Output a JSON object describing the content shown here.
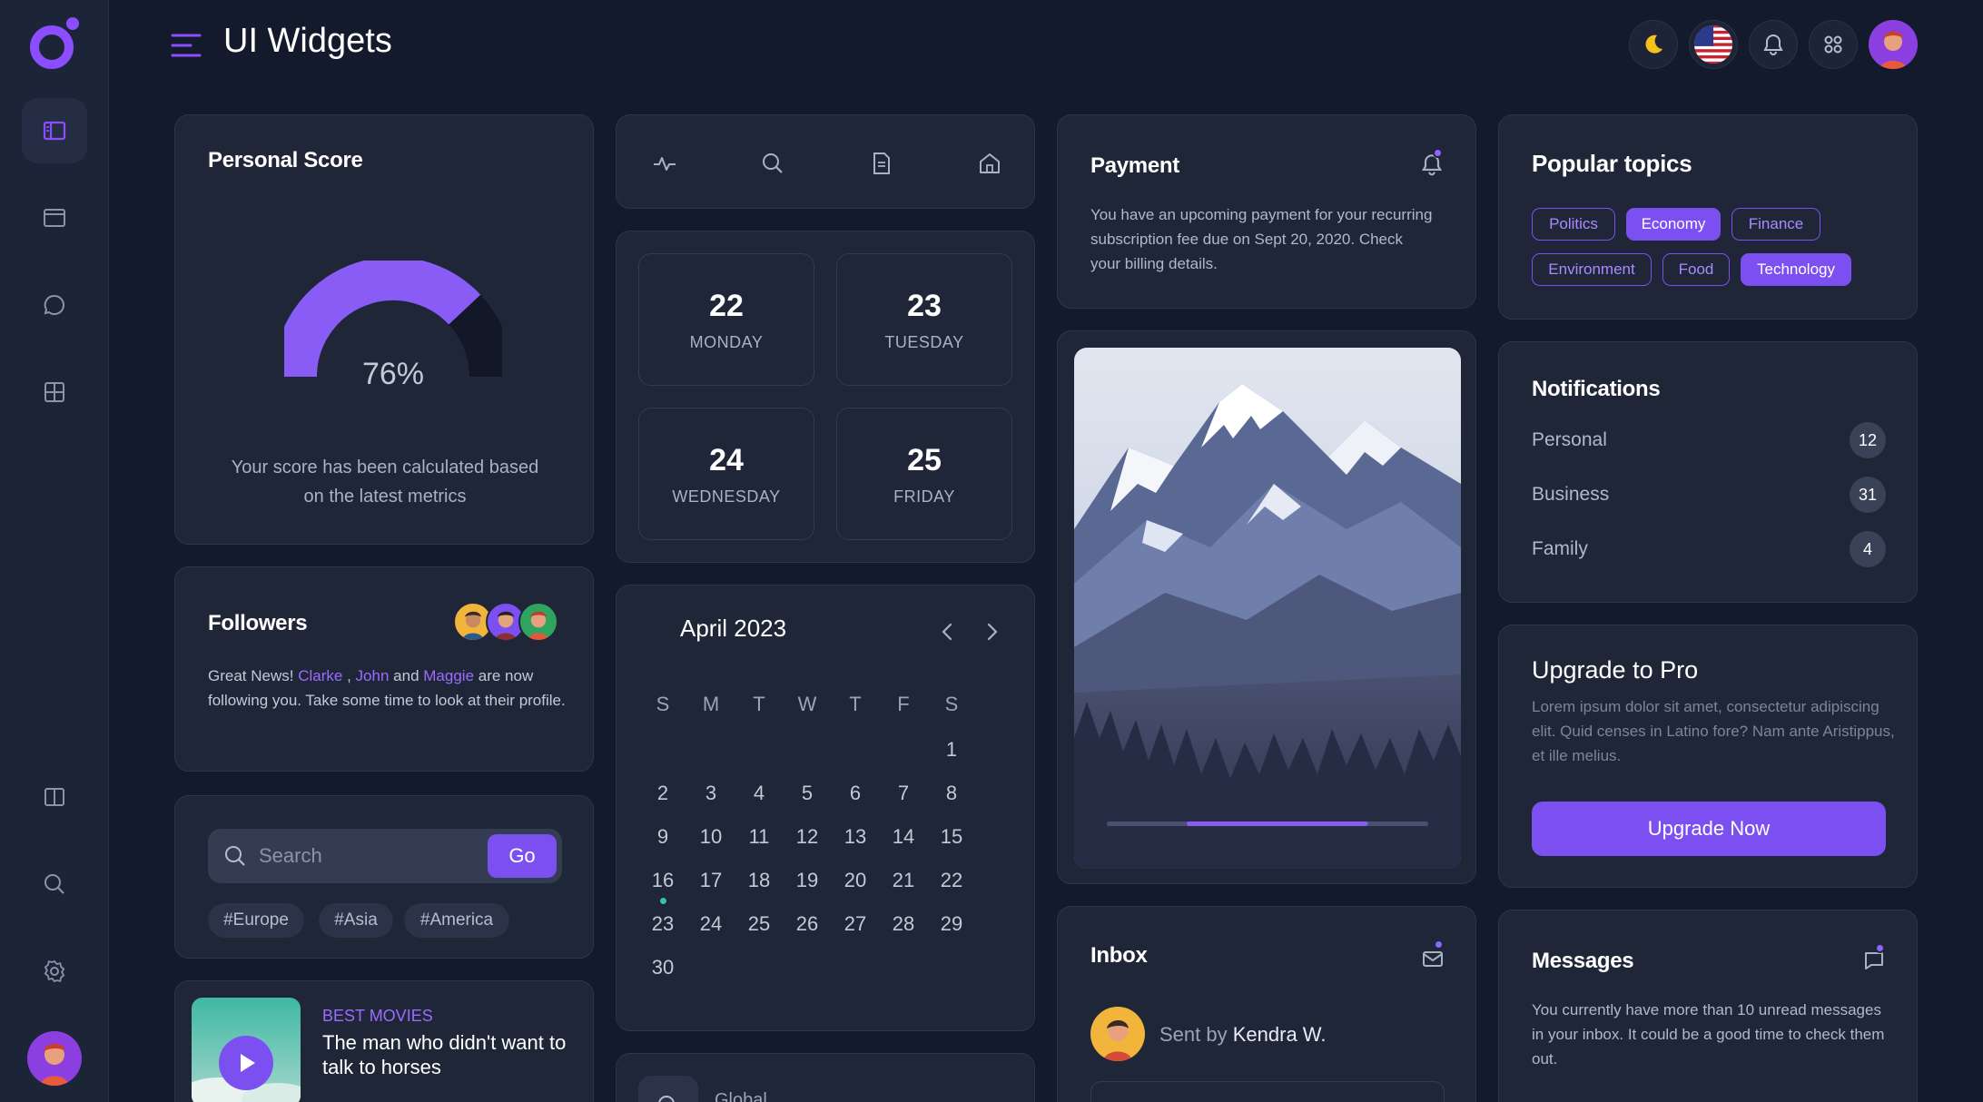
{
  "header": {
    "title": "UI Widgets"
  },
  "personal_score": {
    "title": "Personal Score",
    "value": 76,
    "value_label": "76%",
    "description_line1": "Your score has been calculated based",
    "description_line2": "on the latest metrics"
  },
  "followers": {
    "title": "Followers",
    "text_prefix": "Great News!",
    "name1": "Clarke",
    "sep1": ",",
    "name2": "John",
    "and": "and",
    "name3": "Maggie",
    "text_suffix": "are now following you. Take some time to look at their profile."
  },
  "search": {
    "placeholder": "Search",
    "go_label": "Go",
    "tags": [
      "#Europe",
      "#Asia",
      "#America"
    ]
  },
  "movie": {
    "category": "BEST MOVIES",
    "title": "The man who didn't want to talk to horses"
  },
  "dates": [
    {
      "day": "22",
      "weekday": "MONDAY"
    },
    {
      "day": "23",
      "weekday": "TUESDAY"
    },
    {
      "day": "24",
      "weekday": "WEDNESDAY"
    },
    {
      "day": "25",
      "weekday": "FRIDAY"
    }
  ],
  "calendar": {
    "title": "April 2023",
    "weekday_headers": [
      "S",
      "M",
      "T",
      "W",
      "T",
      "F",
      "S"
    ],
    "rows": [
      [
        "",
        "",
        "",
        "",
        "",
        "",
        "1"
      ],
      [
        "2",
        "3",
        "4",
        "5",
        "6",
        "7",
        "8"
      ],
      [
        "9",
        "10",
        "11",
        "12",
        "13",
        "14",
        "15"
      ],
      [
        "16",
        "17",
        "18",
        "19",
        "20",
        "21",
        "22"
      ],
      [
        "23",
        "24",
        "25",
        "26",
        "27",
        "28",
        "29"
      ],
      [
        "30",
        "",
        "",
        "",
        "",
        "",
        ""
      ]
    ],
    "today": "16"
  },
  "global_card": {
    "label": "Global"
  },
  "payment": {
    "title": "Payment",
    "text": "You have an upcoming payment for your recurring subscription fee due on Sept 20, 2020. Check your billing details."
  },
  "image_card": {
    "progress": 0.75
  },
  "inbox": {
    "title": "Inbox",
    "sent_by_label": "Sent by",
    "sender": "Kendra W."
  },
  "topics": {
    "title": "Popular topics",
    "items": [
      {
        "label": "Politics",
        "selected": false
      },
      {
        "label": "Economy",
        "selected": true
      },
      {
        "label": "Finance",
        "selected": false
      },
      {
        "label": "Environment",
        "selected": false
      },
      {
        "label": "Food",
        "selected": false
      },
      {
        "label": "Technology",
        "selected": true
      }
    ]
  },
  "notifications": {
    "title": "Notifications",
    "items": [
      {
        "label": "Personal",
        "count": "12"
      },
      {
        "label": "Business",
        "count": "31"
      },
      {
        "label": "Family",
        "count": "4"
      }
    ]
  },
  "upgrade": {
    "title": "Upgrade to Pro",
    "text": "Lorem ipsum dolor sit amet, consectetur adipiscing elit. Quid censes in Latino fore? Nam ante Aristippus, et ille melius.",
    "button_label": "Upgrade Now"
  },
  "messages": {
    "title": "Messages",
    "text": "You currently have more than 10 unread messages in your inbox. It could be a good time to check them out."
  },
  "colors": {
    "accent": "#7b4ff0",
    "background": "#131a2c",
    "card": "#1e2638",
    "today_dot": "#35c5a1"
  },
  "icons": {
    "sidebar": [
      "dashboard-icon",
      "browser-icon",
      "chat-icon",
      "grid-icon",
      "columns-icon",
      "search-icon",
      "settings-icon"
    ],
    "topbar": [
      "moon-icon",
      "us-flag-icon",
      "bell-icon",
      "apps-icon"
    ]
  }
}
